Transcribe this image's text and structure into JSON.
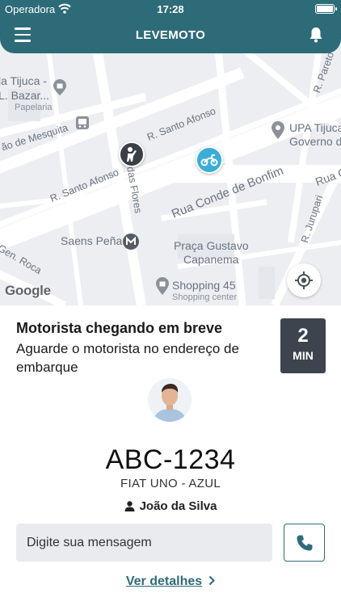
{
  "status_bar": {
    "carrier": "Operadora",
    "time": "17:28",
    "icons": [
      "wifi-icon",
      "battery-icon"
    ]
  },
  "header": {
    "title": "LEVEMOTO",
    "menu_icon": "menu-icon",
    "bell_icon": "bell-icon"
  },
  "map": {
    "labels": {
      "tijuca_bazar_1": "la Tijuca -",
      "tijuca_bazar_2": "L. Bazar...",
      "papelaria": "Papelaria",
      "rua_mesquita": "ão de Mesquita",
      "santo_afonso_1": "R. Santo Afonso",
      "santo_afonso_2": "R. Santo Afonso",
      "upa_1": "UPA Tijuca",
      "upa_2": "Governo de",
      "pareto": "R. Pareto",
      "rua_c": "Rua C",
      "conde_bonfim": "Rua Conde de Bonfim",
      "das_flores": "das Flores",
      "saens_pena": "Saens Peña",
      "gen_roca": "Gen. Roca",
      "praca_1": "Praça Gustavo",
      "praca_2": "Capanema",
      "shopping_1": "Shopping 45",
      "shopping_2": "Shopping center",
      "jurupari": "R. Jurupari"
    },
    "attribution": "Google",
    "user_pin_icon": "person-waving-icon",
    "driver_pin_icon": "motorcycle-icon",
    "locate_icon": "my-location-icon",
    "metro_icon": "metro-icon"
  },
  "trip": {
    "title": "Motorista chegando em breve",
    "subtitle": "Aguarde o motorista no endereço de embarque",
    "eta_value": "2",
    "eta_unit": "MIN",
    "plate": "ABC-1234",
    "car": "FIAT UNO - AZUL",
    "driver_name": "João da Silva",
    "message_placeholder": "Digite sua mensagem",
    "details_link": "Ver detalhes"
  },
  "colors": {
    "brand": "#2e6b78",
    "eta_box": "#3d444d",
    "moto_pin": "#3aaed8",
    "input_bg": "#e9ebee"
  }
}
